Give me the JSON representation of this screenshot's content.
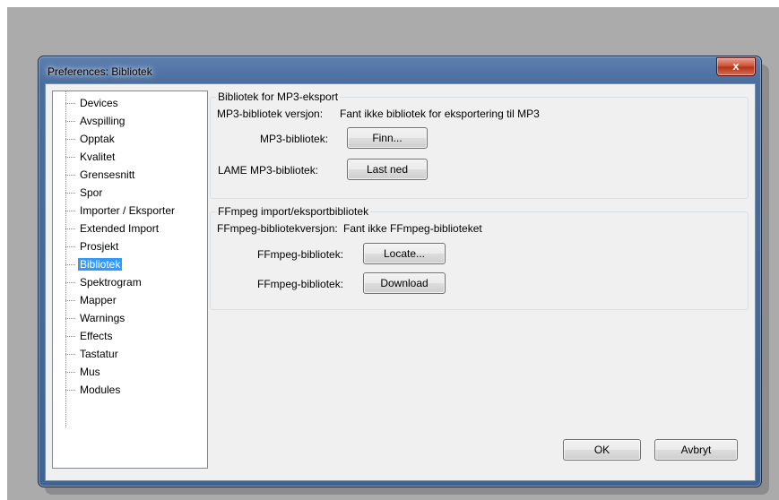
{
  "window": {
    "title": "Preferences: Bibliotek",
    "close_glyph": "x"
  },
  "sidebar": {
    "items": [
      {
        "label": "Devices",
        "selected": false
      },
      {
        "label": "Avspilling",
        "selected": false
      },
      {
        "label": "Opptak",
        "selected": false
      },
      {
        "label": "Kvalitet",
        "selected": false
      },
      {
        "label": "Grensesnitt",
        "selected": false
      },
      {
        "label": "Spor",
        "selected": false
      },
      {
        "label": "Importer / Eksporter",
        "selected": false
      },
      {
        "label": "Extended Import",
        "selected": false
      },
      {
        "label": "Prosjekt",
        "selected": false
      },
      {
        "label": "Bibliotek",
        "selected": true
      },
      {
        "label": "Spektrogram",
        "selected": false
      },
      {
        "label": "Mapper",
        "selected": false
      },
      {
        "label": "Warnings",
        "selected": false
      },
      {
        "label": "Effects",
        "selected": false
      },
      {
        "label": "Tastatur",
        "selected": false
      },
      {
        "label": "Mus",
        "selected": false
      },
      {
        "label": "Modules",
        "selected": false
      }
    ]
  },
  "mp3_group": {
    "title": "Bibliotek for MP3-eksport",
    "version_label": "MP3-bibliotek versjon:",
    "version_value": "Fant ikke bibliotek for eksportering til MP3",
    "library_label": "MP3-bibliotek:",
    "find_button": "Finn...",
    "lame_label": "LAME MP3-bibliotek:",
    "download_button": "Last ned"
  },
  "ffmpeg_group": {
    "title": "FFmpeg import/eksportbibliotek",
    "version_label": "FFmpeg-bibliotekversjon:",
    "version_value": "Fant ikke FFmpeg-biblioteket",
    "library_label": "FFmpeg-bibliotek:",
    "locate_button": "Locate...",
    "library_label_2": "FFmpeg-bibliotek:",
    "download_button": "Download"
  },
  "footer": {
    "ok_button": "OK",
    "cancel_button": "Avbryt"
  }
}
